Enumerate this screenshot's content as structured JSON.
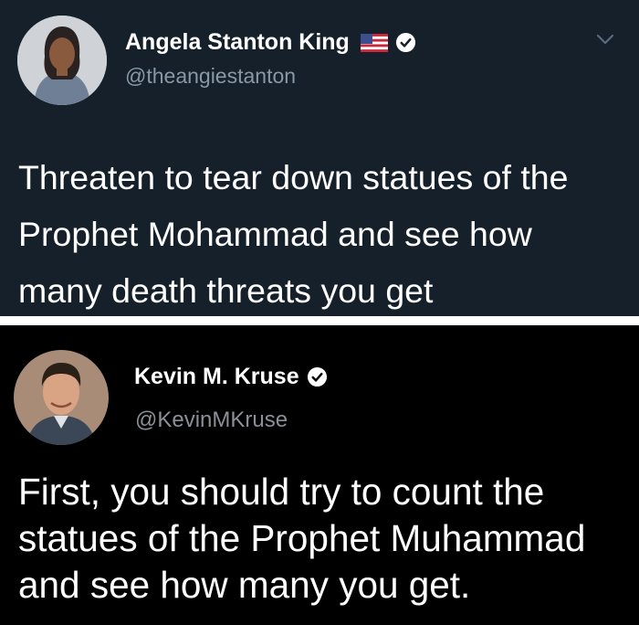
{
  "tweets": [
    {
      "author": {
        "name": "Angela Stanton King",
        "handle": "@theangiestanton",
        "flag_icon": "us-flag-icon",
        "verified_icon": "verified-badge-icon",
        "avatar": "profile-photo"
      },
      "menu_icon": "chevron-down-icon",
      "text_lines": [
        "Threaten to tear down statues of the",
        "Prophet Mohammad and see how",
        "many death threats you get"
      ],
      "colors": {
        "background": "#16202b",
        "text": "#ffffff",
        "handle": "#8899a6"
      }
    },
    {
      "author": {
        "name": "Kevin M. Kruse",
        "handle": "@KevinMKruse",
        "verified_icon": "verified-badge-icon",
        "avatar": "profile-photo"
      },
      "text_lines": [
        "First, you should try to count the",
        "statues of the Prophet Muhammad",
        "and see how many you get."
      ],
      "colors": {
        "background": "#000000",
        "text": "#ffffff",
        "handle": "#8a9097"
      }
    }
  ]
}
